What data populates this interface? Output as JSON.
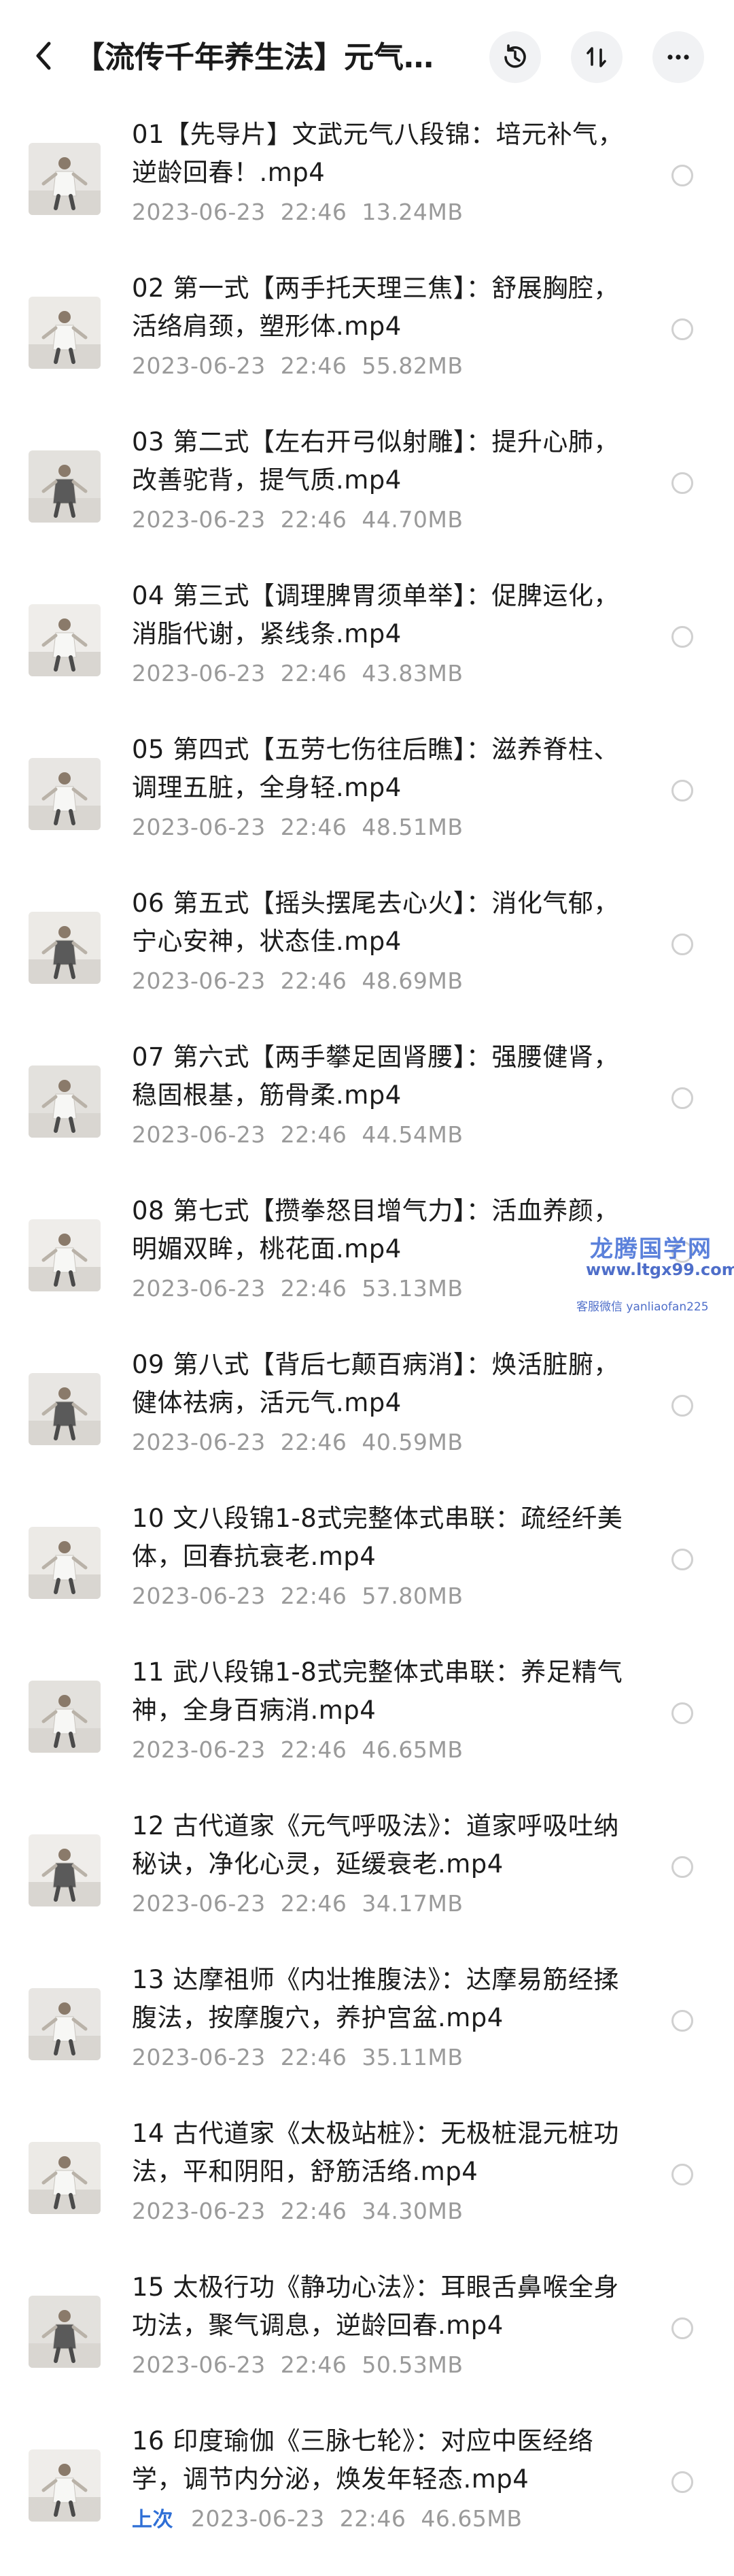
{
  "header": {
    "title": "【流传千年养生法】元气八段锦…",
    "back_icon": "chevron-left-icon",
    "history_icon": "history-clock-icon",
    "sort_icon": "sort-icon",
    "more_icon": "more-dots-icon"
  },
  "files": [
    {
      "name": "01【先导片】文武元气八段锦：培元补气，逆龄回春！.mp4",
      "date": "2023-06-23",
      "time": "22:46",
      "size": "13.24MB"
    },
    {
      "name": "02 第一式【两手托天理三焦】：舒展胸腔，活络肩颈，塑形体.mp4",
      "date": "2023-06-23",
      "time": "22:46",
      "size": "55.82MB"
    },
    {
      "name": "03 第二式【左右开弓似射雕】：提升心肺，改善驼背，提气质.mp4",
      "date": "2023-06-23",
      "time": "22:46",
      "size": "44.70MB"
    },
    {
      "name": "04 第三式【调理脾胃须单举】：促脾运化，消脂代谢，紧线条.mp4",
      "date": "2023-06-23",
      "time": "22:46",
      "size": "43.83MB"
    },
    {
      "name": "05 第四式【五劳七伤往后瞧】：滋养脊柱、调理五脏，全身轻.mp4",
      "date": "2023-06-23",
      "time": "22:46",
      "size": "48.51MB"
    },
    {
      "name": "06 第五式【摇头摆尾去心火】：消化气郁，宁心安神，状态佳.mp4",
      "date": "2023-06-23",
      "time": "22:46",
      "size": "48.69MB"
    },
    {
      "name": "07 第六式【两手攀足固肾腰】：强腰健肾，稳固根基，筋骨柔.mp4",
      "date": "2023-06-23",
      "time": "22:46",
      "size": "44.54MB"
    },
    {
      "name": "08 第七式【攒拳怒目增气力】：活血养颜，明媚双眸，桃花面.mp4",
      "date": "2023-06-23",
      "time": "22:46",
      "size": "53.13MB"
    },
    {
      "name": "09 第八式【背后七颠百病消】：焕活脏腑，健体祛病，活元气.mp4",
      "date": "2023-06-23",
      "time": "22:46",
      "size": "40.59MB"
    },
    {
      "name": "10 文八段锦1-8式完整体式串联：疏经纤美体，回春抗衰老.mp4",
      "date": "2023-06-23",
      "time": "22:46",
      "size": "57.80MB"
    },
    {
      "name": "11 武八段锦1-8式完整体式串联：养足精气神，全身百病消.mp4",
      "date": "2023-06-23",
      "time": "22:46",
      "size": "46.65MB"
    },
    {
      "name": "12 古代道家《元气呼吸法》：道家呼吸吐纳秘诀，净化心灵，延缓衰老.mp4",
      "date": "2023-06-23",
      "time": "22:46",
      "size": "34.17MB"
    },
    {
      "name": "13 达摩祖师《内壮推腹法》：达摩易筋经揉腹法，按摩腹穴，养护宫盆.mp4",
      "date": "2023-06-23",
      "time": "22:46",
      "size": "35.11MB"
    },
    {
      "name": "14 古代道家《太极站桩》：无极桩混元桩功法，平和阴阳，舒筋活络.mp4",
      "date": "2023-06-23",
      "time": "22:46",
      "size": "34.30MB"
    },
    {
      "name": "15 太极行功《静功心法》：耳眼舌鼻喉全身功法，聚气调息，逆龄回春.mp4",
      "date": "2023-06-23",
      "time": "22:46",
      "size": "50.53MB"
    },
    {
      "name": "16 印度瑜伽《三脉七轮》：对应中医经络学，调节内分泌，焕发年轻态.mp4",
      "date": "2023-06-23",
      "time": "22:46",
      "size": "46.65MB",
      "badge": "上次"
    }
  ],
  "watermark": {
    "site_name": "龙腾国学网",
    "url": "www.ltgx99.com",
    "contact": "客服微信 yanliaofan225"
  },
  "colors": {
    "accent": "#2f6fd6",
    "meta_gray": "#9a9a9a",
    "radio_border": "#d0d0d0"
  }
}
